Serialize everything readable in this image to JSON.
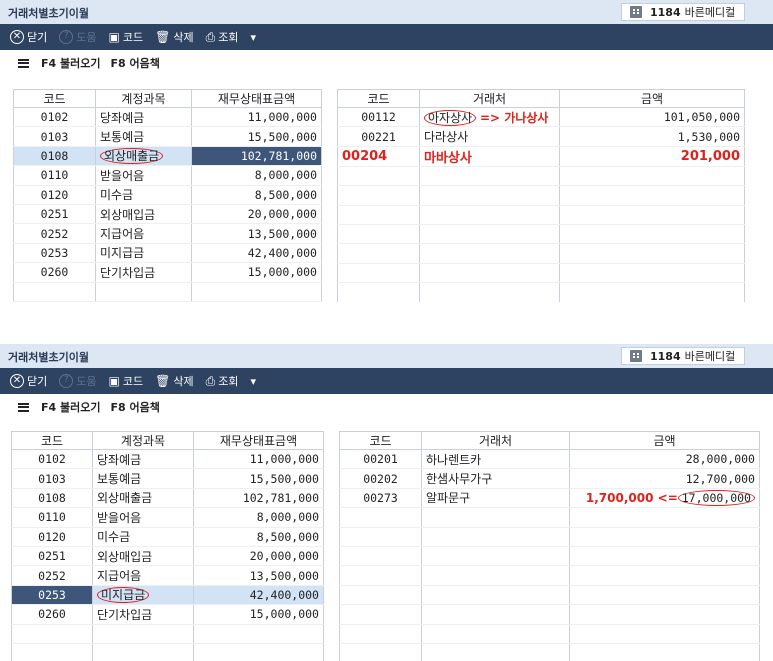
{
  "panels": [
    {
      "window_title": "거래처별초기이월",
      "company": {
        "code": "1184",
        "name": "바른메디컬"
      },
      "toolbar": {
        "close": "닫기",
        "help": "도움",
        "code": "코드",
        "delete": "삭제",
        "search": "조회",
        "more": "▾"
      },
      "subbar": {
        "f4": "F4 불러오기",
        "f8": "F8 어음책"
      },
      "left_headers": {
        "code": "코드",
        "account": "계정과목",
        "amount": "재무상태표금액"
      },
      "accounts": [
        {
          "code": "0102",
          "name": "당좌예금",
          "amount": "11,000,000"
        },
        {
          "code": "0103",
          "name": "보통예금",
          "amount": "15,500,000"
        },
        {
          "code": "0108",
          "name": "외상매출금",
          "amount": "102,781,000"
        },
        {
          "code": "0110",
          "name": "받을어음",
          "amount": "8,000,000"
        },
        {
          "code": "0120",
          "name": "미수금",
          "amount": "8,500,000"
        },
        {
          "code": "0251",
          "name": "외상매입금",
          "amount": "20,000,000"
        },
        {
          "code": "0252",
          "name": "지급어음",
          "amount": "13,500,000"
        },
        {
          "code": "0253",
          "name": "미지급금",
          "amount": "42,400,000"
        },
        {
          "code": "0260",
          "name": "단기차입금",
          "amount": "15,000,000"
        }
      ],
      "right_headers": {
        "code": "코드",
        "vendor": "거래처",
        "amount": "금액"
      },
      "vendors": [
        {
          "code": "00112",
          "name": "아자상사",
          "amount": "101,050,000",
          "note": "=> 가나상사"
        },
        {
          "code": "00221",
          "name": "다라상사",
          "amount": "1,530,000"
        },
        {
          "code": "00204",
          "name": "마바상사",
          "amount": "201,000"
        }
      ]
    },
    {
      "window_title": "거래처별초기이월",
      "company": {
        "code": "1184",
        "name": "바른메디컬"
      },
      "toolbar": {
        "close": "닫기",
        "help": "도움",
        "code": "코드",
        "delete": "삭제",
        "search": "조회",
        "more": "▾"
      },
      "subbar": {
        "f4": "F4 불러오기",
        "f8": "F8 어음책"
      },
      "left_headers": {
        "code": "코드",
        "account": "계정과목",
        "amount": "재무상태표금액"
      },
      "accounts": [
        {
          "code": "0102",
          "name": "당좌예금",
          "amount": "11,000,000"
        },
        {
          "code": "0103",
          "name": "보통예금",
          "amount": "15,500,000"
        },
        {
          "code": "0108",
          "name": "외상매출금",
          "amount": "102,781,000"
        },
        {
          "code": "0110",
          "name": "받을어음",
          "amount": "8,000,000"
        },
        {
          "code": "0120",
          "name": "미수금",
          "amount": "8,500,000"
        },
        {
          "code": "0251",
          "name": "외상매입금",
          "amount": "20,000,000"
        },
        {
          "code": "0252",
          "name": "지급어음",
          "amount": "13,500,000"
        },
        {
          "code": "0253",
          "name": "미지급금",
          "amount": "42,400,000"
        },
        {
          "code": "0260",
          "name": "단기차입금",
          "amount": "15,000,000"
        }
      ],
      "right_headers": {
        "code": "코드",
        "vendor": "거래처",
        "amount": "금액"
      },
      "vendors": [
        {
          "code": "00201",
          "name": "하나렌트카",
          "amount": "28,000,000"
        },
        {
          "code": "00202",
          "name": "한샘사무가구",
          "amount": "12,700,000"
        },
        {
          "code": "00273",
          "name": "알파문구",
          "amount": "17,000,000",
          "note": "1,700,000 <="
        }
      ]
    }
  ]
}
